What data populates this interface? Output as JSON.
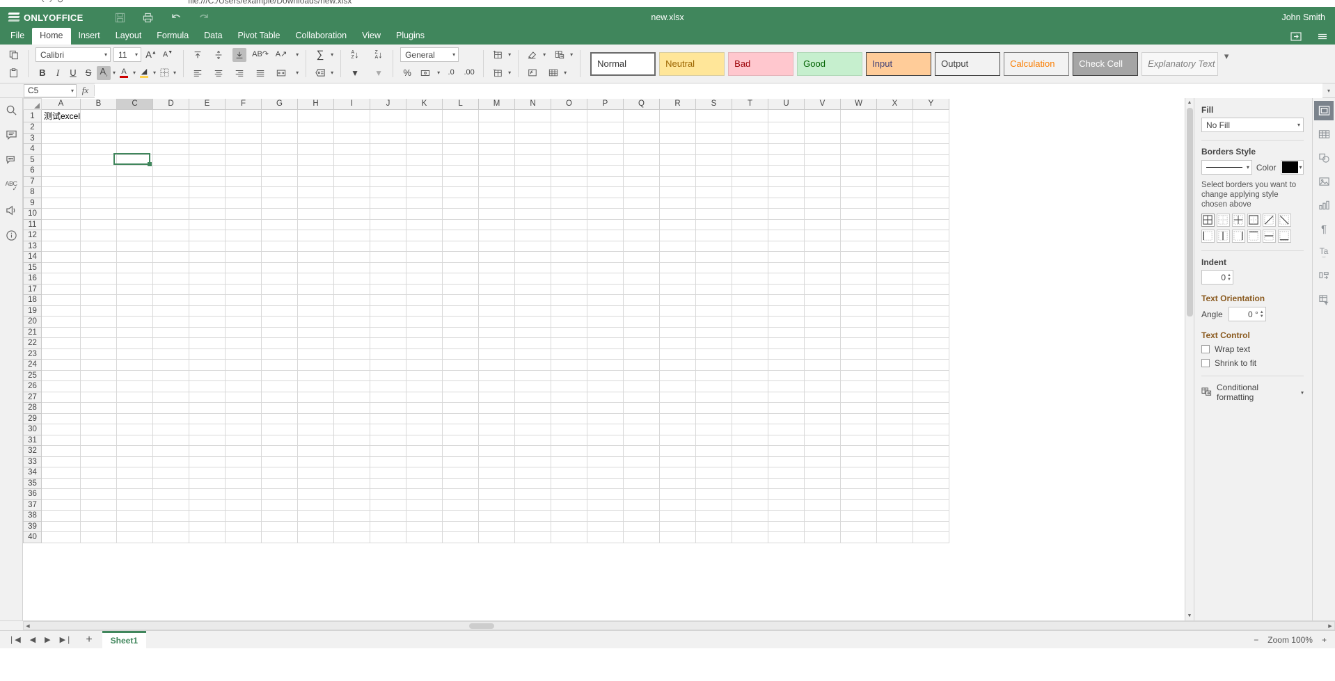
{
  "browser": {
    "address_text": "file:///C:/Users/example/Downloads/new.xlsx"
  },
  "titlebar": {
    "brand": "ONLYOFFICE",
    "document_title": "new.xlsx",
    "user": "John Smith",
    "tools": [
      {
        "name": "save-icon",
        "glyph": "💾",
        "disabled": true
      },
      {
        "name": "print-icon",
        "glyph": "⎙",
        "disabled": false
      },
      {
        "name": "undo-icon",
        "glyph": "↶",
        "disabled": false
      },
      {
        "name": "redo-icon",
        "glyph": "↷",
        "disabled": true
      }
    ]
  },
  "tabs": [
    {
      "label": "File",
      "active": false
    },
    {
      "label": "Home",
      "active": true
    },
    {
      "label": "Insert",
      "active": false
    },
    {
      "label": "Layout",
      "active": false
    },
    {
      "label": "Formula",
      "active": false
    },
    {
      "label": "Data",
      "active": false
    },
    {
      "label": "Pivot Table",
      "active": false
    },
    {
      "label": "Collaboration",
      "active": false
    },
    {
      "label": "View",
      "active": false
    },
    {
      "label": "Plugins",
      "active": false
    }
  ],
  "ribbon": {
    "font_name": "Calibri",
    "font_size": "11",
    "number_format": "General",
    "buttons": {
      "copy": "❐",
      "paste": "📋",
      "bold": "B",
      "italic": "I",
      "underline": "U",
      "strikeout": "S",
      "subsuper": "A",
      "font_color": "A",
      "fill_color": "◢",
      "borders": "▦",
      "grow_font": "A",
      "shrink_font": "A",
      "align_top": "⤒",
      "align_middle": "↕",
      "align_bottom": "⤓",
      "wrap_text": "AB",
      "orientation": "A",
      "align_left": "≡",
      "align_center": "≡",
      "align_right": "≡",
      "align_justify": "≡",
      "merge_cells": "⊞",
      "autosum": "∑",
      "named_ranges": "⊟",
      "sort_asc": "A↓",
      "sort_desc": "Z↓",
      "filter": "▼",
      "clear_filter": "▽",
      "percent_style": "%",
      "currency_style": "¤",
      "decimal_decrease": ".0",
      "decimal_increase": ".00",
      "insert_cells": "⊞",
      "delete_cells": "⊟",
      "clear": "⌫",
      "format_as_table": "▤",
      "conditional": "▥"
    }
  },
  "cell_styles": [
    {
      "label": "Normal",
      "bg": "#ffffff",
      "fg": "#333333",
      "border": "#6a6a6a",
      "selected": true,
      "italic": false
    },
    {
      "label": "Neutral",
      "bg": "#ffe699",
      "fg": "#9c6500",
      "border": "#d8cda0",
      "selected": false,
      "italic": false
    },
    {
      "label": "Bad",
      "bg": "#ffc7ce",
      "fg": "#9c0006",
      "border": "#e3b3b9",
      "selected": false,
      "italic": false
    },
    {
      "label": "Good",
      "bg": "#c6efce",
      "fg": "#006100",
      "border": "#b0d8b7",
      "selected": false,
      "italic": false
    },
    {
      "label": "Input",
      "bg": "#ffcc99",
      "fg": "#3f3f76",
      "border": "#3f3f3f",
      "selected": false,
      "italic": false
    },
    {
      "label": "Output",
      "bg": "#f2f2f2",
      "fg": "#3f3f3f",
      "border": "#3f3f3f",
      "selected": false,
      "italic": false
    },
    {
      "label": "Calculation",
      "bg": "#f2f2f2",
      "fg": "#fa7d00",
      "border": "#7f7f7f",
      "selected": false,
      "italic": false
    },
    {
      "label": "Check Cell",
      "bg": "#a5a5a5",
      "fg": "#ffffff",
      "border": "#3f3f3f",
      "selected": false,
      "italic": false
    },
    {
      "label": "Explanatory Text",
      "bg": "#f7f7f7",
      "fg": "#7f7f7f",
      "border": "#d0d0d0",
      "selected": false,
      "italic": true
    }
  ],
  "formula_bar": {
    "name_box": "C5",
    "fx_label": "fx",
    "formula_value": ""
  },
  "left_sidebar": [
    {
      "name": "search-icon",
      "glyph": "⚲"
    },
    {
      "name": "comments-icon",
      "glyph": "🗪"
    },
    {
      "name": "chat-icon",
      "glyph": "💬"
    },
    {
      "name": "spellcheck-icon",
      "glyph": "ABC"
    },
    {
      "name": "feedback-icon",
      "glyph": "📢"
    },
    {
      "name": "about-icon",
      "glyph": "ⓘ"
    }
  ],
  "right_rail": [
    {
      "name": "cell-settings-icon",
      "glyph": "▣",
      "active": true
    },
    {
      "name": "table-settings-icon",
      "glyph": "▦",
      "active": false
    },
    {
      "name": "shape-settings-icon",
      "glyph": "○",
      "active": false
    },
    {
      "name": "image-settings-icon",
      "glyph": "🖼",
      "active": false
    },
    {
      "name": "chart-settings-icon",
      "glyph": "📊",
      "active": false
    },
    {
      "name": "paragraph-settings-icon",
      "glyph": "¶",
      "active": false
    },
    {
      "name": "text-art-settings-icon",
      "glyph": "Ta",
      "active": false
    },
    {
      "name": "slicer-settings-icon",
      "glyph": "⌷",
      "active": false
    },
    {
      "name": "pivot-settings-icon",
      "glyph": "▤",
      "active": false
    }
  ],
  "right_panel": {
    "fill_heading": "Fill",
    "fill_value": "No Fill",
    "borders_heading": "Borders Style",
    "border_color_label": "Color",
    "border_color": "#000000",
    "borders_hint": "Select borders you want to change applying style chosen above",
    "border_buttons_row1": [
      "all-borders",
      "no-borders",
      "inner-borders",
      "outer-borders",
      "diagonal-up-border",
      "diagonal-down-border"
    ],
    "border_buttons_row2": [
      "left-border",
      "inner-vertical-border",
      "right-border",
      "top-border",
      "inner-horizontal-border",
      "bottom-border"
    ],
    "indent_heading": "Indent",
    "indent_value": "0",
    "orientation_heading": "Text Orientation",
    "angle_label": "Angle",
    "angle_value": "0 °",
    "text_control_heading": "Text Control",
    "wrap_text_label": "Wrap text",
    "wrap_text_checked": false,
    "shrink_to_fit_label": "Shrink to fit",
    "shrink_to_fit_checked": false,
    "conditional_formatting_label": "Conditional formatting"
  },
  "grid": {
    "columns": [
      "A",
      "B",
      "C",
      "D",
      "E",
      "F",
      "G",
      "H",
      "I",
      "J",
      "K",
      "L",
      "M",
      "N",
      "O",
      "P",
      "Q",
      "R",
      "S",
      "T",
      "U",
      "V",
      "W",
      "X",
      "Y"
    ],
    "active_column": "C",
    "rows": [
      1,
      2,
      3,
      4,
      5,
      6,
      7,
      8,
      9,
      10,
      11,
      12,
      13,
      14,
      15,
      16,
      17,
      18,
      19,
      20,
      21,
      22,
      23,
      24,
      25,
      26,
      27,
      28,
      29,
      30,
      31,
      32,
      33,
      34,
      35,
      36,
      37,
      38,
      39,
      40
    ],
    "active_row": 5,
    "cells": [
      {
        "ref": "A1",
        "row": 1,
        "col": "A",
        "value": "测试excel"
      }
    ],
    "selection": "C5"
  },
  "status_bar": {
    "nav_first": "❘◀",
    "nav_prev": "◀",
    "nav_next": "▶",
    "nav_last": "▶❘",
    "add_sheet": "+",
    "sheets": [
      {
        "label": "Sheet1",
        "active": true
      }
    ],
    "zoom_out": "−",
    "zoom_label": "Zoom 100%",
    "zoom_in": "+"
  }
}
